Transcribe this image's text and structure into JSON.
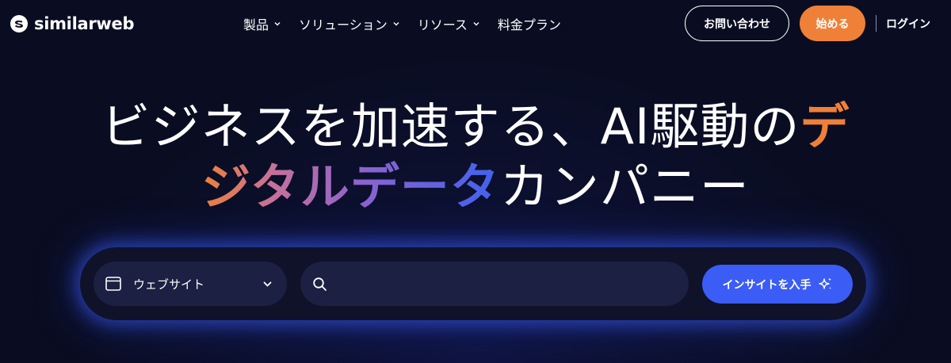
{
  "header": {
    "logo_text": "similarweb",
    "nav": [
      {
        "label": "製品",
        "has_dropdown": true
      },
      {
        "label": "ソリューション",
        "has_dropdown": true
      },
      {
        "label": "リソース",
        "has_dropdown": true
      },
      {
        "label": "料金プラン",
        "has_dropdown": false
      }
    ],
    "contact_label": "お問い合わせ",
    "start_label": "始める",
    "login_label": "ログイン"
  },
  "hero": {
    "line1_plain": "ビジネスを加速する、AI駆動の",
    "line1_accent": "デ",
    "line2_accent": "ジタルデータ",
    "line2_plain": "カンパニー"
  },
  "search": {
    "type_label": "ウェブサイト",
    "input_value": "",
    "input_placeholder": "",
    "submit_label": "インサイトを入手"
  },
  "colors": {
    "background": "#0a0d22",
    "accent_orange": "#ef8038",
    "accent_blue": "#3b5cf5",
    "field_bg": "#1c2042"
  },
  "icons": {
    "logo": "similarweb-logo-icon",
    "nav_dropdown": "chevron-down-icon",
    "type_select": "browser-window-icon",
    "search": "search-icon",
    "submit": "sparkle-icon"
  }
}
